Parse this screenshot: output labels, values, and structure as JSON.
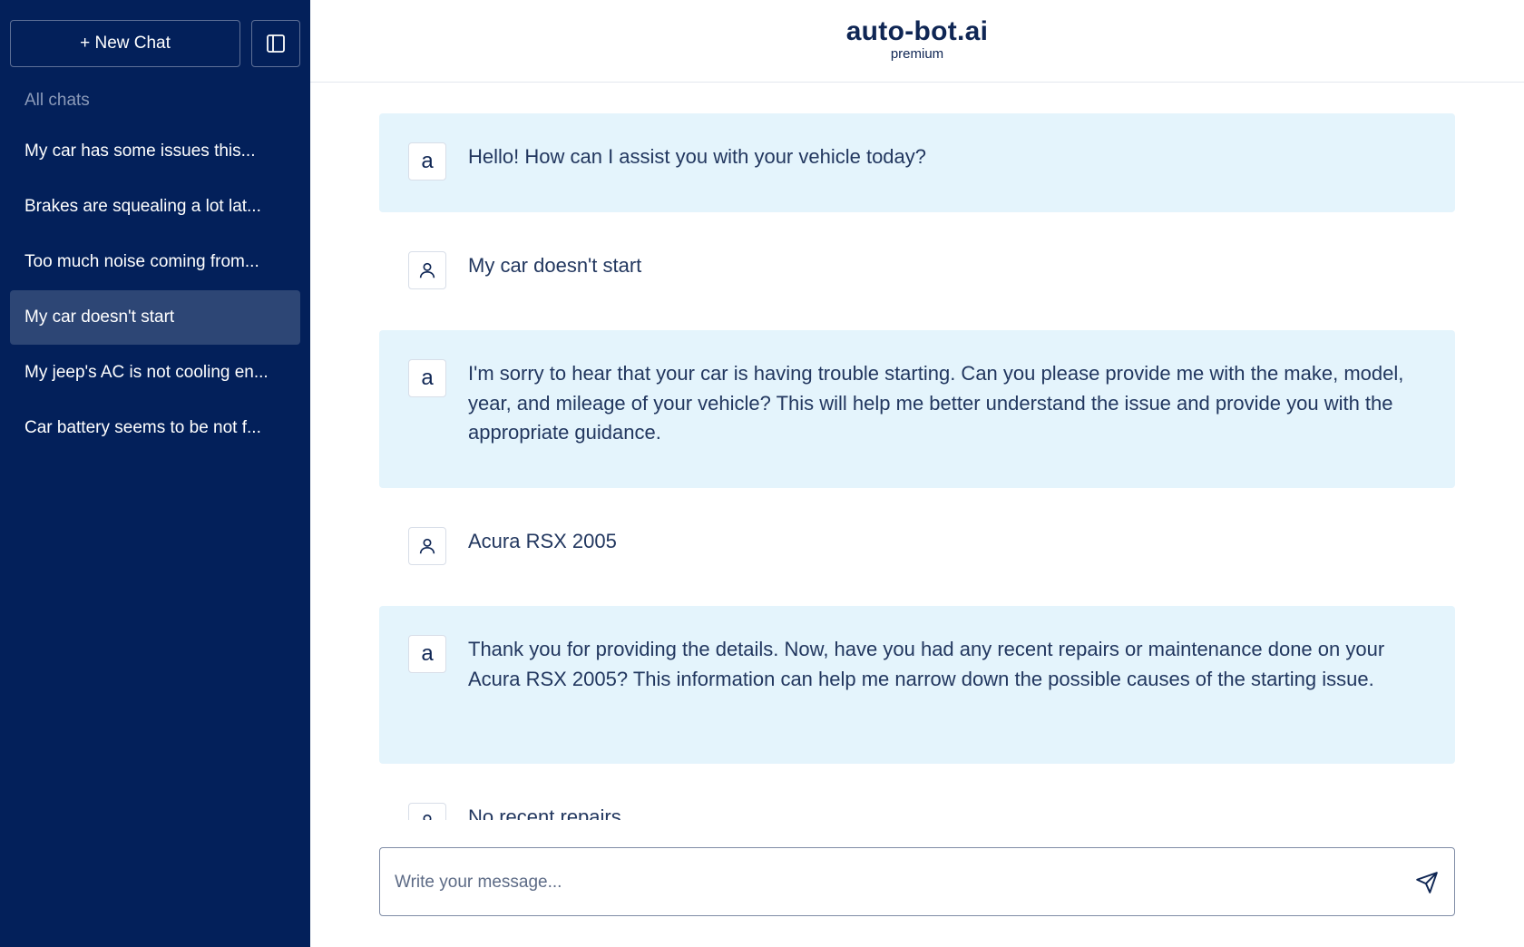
{
  "sidebar": {
    "new_chat_label": "+ New Chat",
    "section_label": "All chats",
    "items": [
      {
        "label": "My car has some issues this..."
      },
      {
        "label": "Brakes are squealing a lot lat..."
      },
      {
        "label": "Too much noise coming from..."
      },
      {
        "label": "My car doesn't start"
      },
      {
        "label": "My jeep's AC is not cooling en..."
      },
      {
        "label": "Car battery seems to be not f..."
      }
    ],
    "active_index": 3
  },
  "header": {
    "title": "auto-bot.ai",
    "subtitle": "premium"
  },
  "messages": [
    {
      "role": "bot",
      "avatar": "a",
      "text": "Hello! How can I assist you with your vehicle today?"
    },
    {
      "role": "user",
      "avatar": "user-icon",
      "text": "My car doesn't start"
    },
    {
      "role": "bot",
      "avatar": "a",
      "text": "I'm sorry to hear that your car is having trouble starting. Can you please provide me with the make, model, year, and mileage of your vehicle? This will help me better understand the issue and provide you with the appropriate guidance."
    },
    {
      "role": "user",
      "avatar": "user-icon",
      "text": "Acura RSX 2005"
    },
    {
      "role": "bot",
      "avatar": "a",
      "text": "Thank you for providing the details. Now, have you had any recent repairs or maintenance done on your Acura RSX 2005? This information can help me narrow down the possible causes of the starting issue."
    },
    {
      "role": "user",
      "avatar": "user-icon",
      "text": "No recent repairs"
    }
  ],
  "composer": {
    "placeholder": "Write your message...",
    "value": ""
  },
  "icons": {
    "toggle": "sidebar-toggle-icon",
    "send": "send-icon",
    "user": "user-icon"
  },
  "colors": {
    "sidebar_bg": "#03205a",
    "active_item_bg": "#2d4675",
    "bot_bubble_bg": "#e4f4fc",
    "text_primary": "#0f2654"
  }
}
